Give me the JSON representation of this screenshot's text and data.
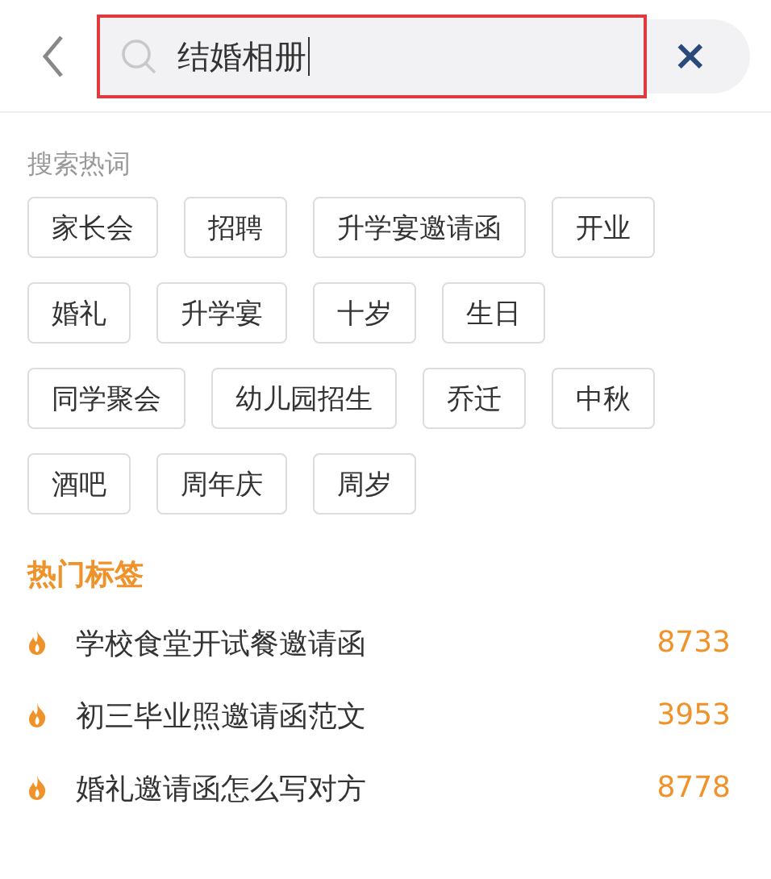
{
  "search": {
    "value": "结婚相册",
    "clear_label": "×"
  },
  "hot_words": {
    "title": "搜索热词",
    "chips": [
      [
        "家长会",
        "招聘",
        "升学宴邀请函",
        "开业"
      ],
      [
        "婚礼",
        "升学宴",
        "十岁",
        "生日"
      ],
      [
        "同学聚会",
        "幼儿园招生",
        "乔迁",
        "中秋"
      ],
      [
        "酒吧",
        "周年庆",
        "周岁"
      ]
    ]
  },
  "hot_tags": {
    "title": "热门标签",
    "items": [
      {
        "text": "学校食堂开试餐邀请函",
        "count": "8733"
      },
      {
        "text": "初三毕业照邀请函范文",
        "count": "3953"
      },
      {
        "text": "婚礼邀请函怎么写对方",
        "count": "8778"
      }
    ]
  }
}
